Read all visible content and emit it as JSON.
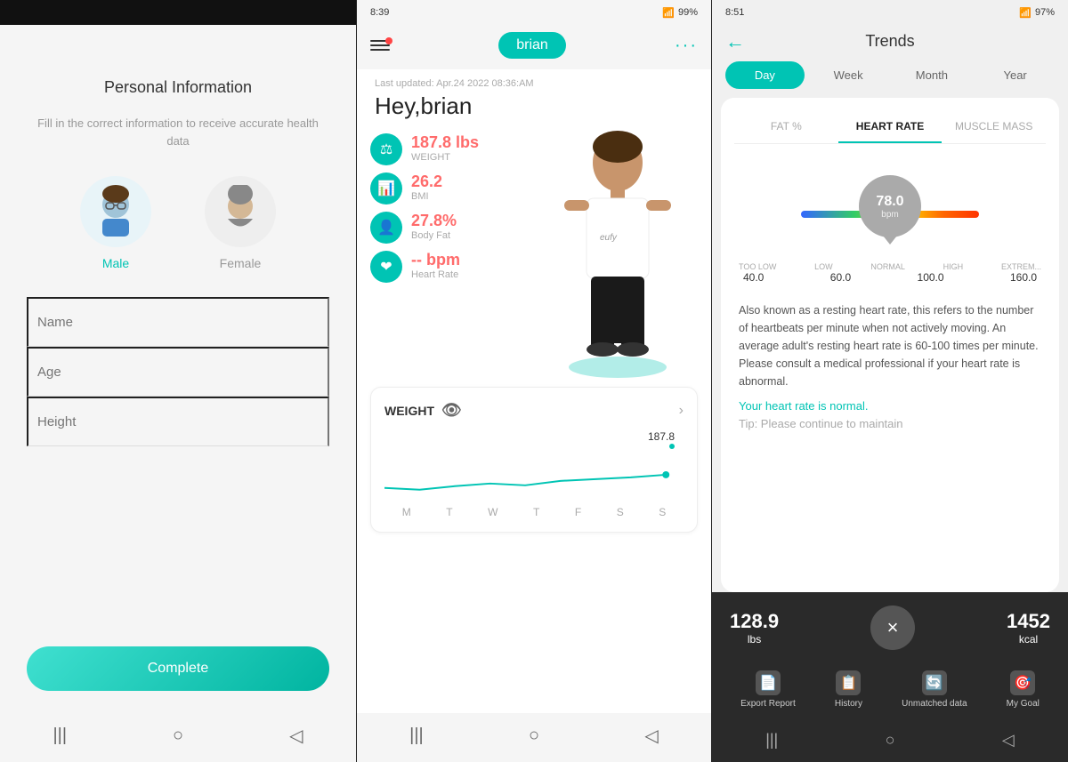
{
  "panel1": {
    "title": "Personal Information",
    "subtitle": "Fill in the correct information to receive accurate health data",
    "gender_male": "Male",
    "gender_female": "Female",
    "field_name": "Name",
    "field_age": "Age",
    "field_height": "Height",
    "complete_btn": "Complete",
    "nav_back": "◁",
    "nav_home": "○",
    "nav_menu": "|||"
  },
  "panel2": {
    "status_time": "8:39",
    "status_battery": "99%",
    "user_name": "brian",
    "last_updated": "Last updated: Apr.24 2022 08:36:AM",
    "greeting": "Hey,brian",
    "weight_value": "187.8 lbs",
    "weight_label": "WEIGHT",
    "bmi_value": "26.2",
    "bmi_label": "BMI",
    "bodyfat_value": "27.8%",
    "bodyfat_label": "Body Fat",
    "heartrate_value": "-- bpm",
    "heartrate_label": "Heart Rate",
    "weight_section_title": "WEIGHT",
    "chart_value": "187.8",
    "chart_days": [
      "M",
      "T",
      "W",
      "T",
      "F",
      "S",
      "S"
    ],
    "eufy_label": "eufy",
    "nav_back": "◁",
    "nav_home": "○",
    "nav_menu": "|||"
  },
  "panel3": {
    "status_time": "8:51",
    "status_battery": "97%",
    "back_btn": "←",
    "title": "Trends",
    "time_tabs": [
      "Day",
      "Week",
      "Month",
      "Year"
    ],
    "active_time_tab": 0,
    "metric_tabs": [
      "FAT %",
      "HEART RATE",
      "MUSCLE MASS"
    ],
    "active_metric_tab": 1,
    "gauge_value": "78.0",
    "gauge_unit": "bpm",
    "gauge_labels": [
      "TOO LOW",
      "LOW",
      "NORMAL",
      "HIGH",
      "EXTREM..."
    ],
    "gauge_numbers": [
      "40.0",
      "60.0",
      "100.0",
      "160.0"
    ],
    "description": "Also known as a resting heart rate, this refers to the number of heartbeats per minute when not actively moving. An average adult's resting heart rate is 60-100 times per minute. Please consult a medical professional if your heart rate is abnormal.",
    "normal_text": "Your heart rate is normal.",
    "tip_text": "Tip: Please continue to maintain",
    "bottom_weight": "128.9",
    "bottom_weight_unit": "lbs",
    "bottom_calories": "1452",
    "bottom_calories_unit": "kcal",
    "close_icon": "×",
    "nav_items": [
      "Export Report",
      "History",
      "Unmatched data",
      "My Goal"
    ],
    "nav_back_bottom": "◁",
    "nav_home_bottom": "○",
    "nav_menu_bottom": "|||"
  }
}
